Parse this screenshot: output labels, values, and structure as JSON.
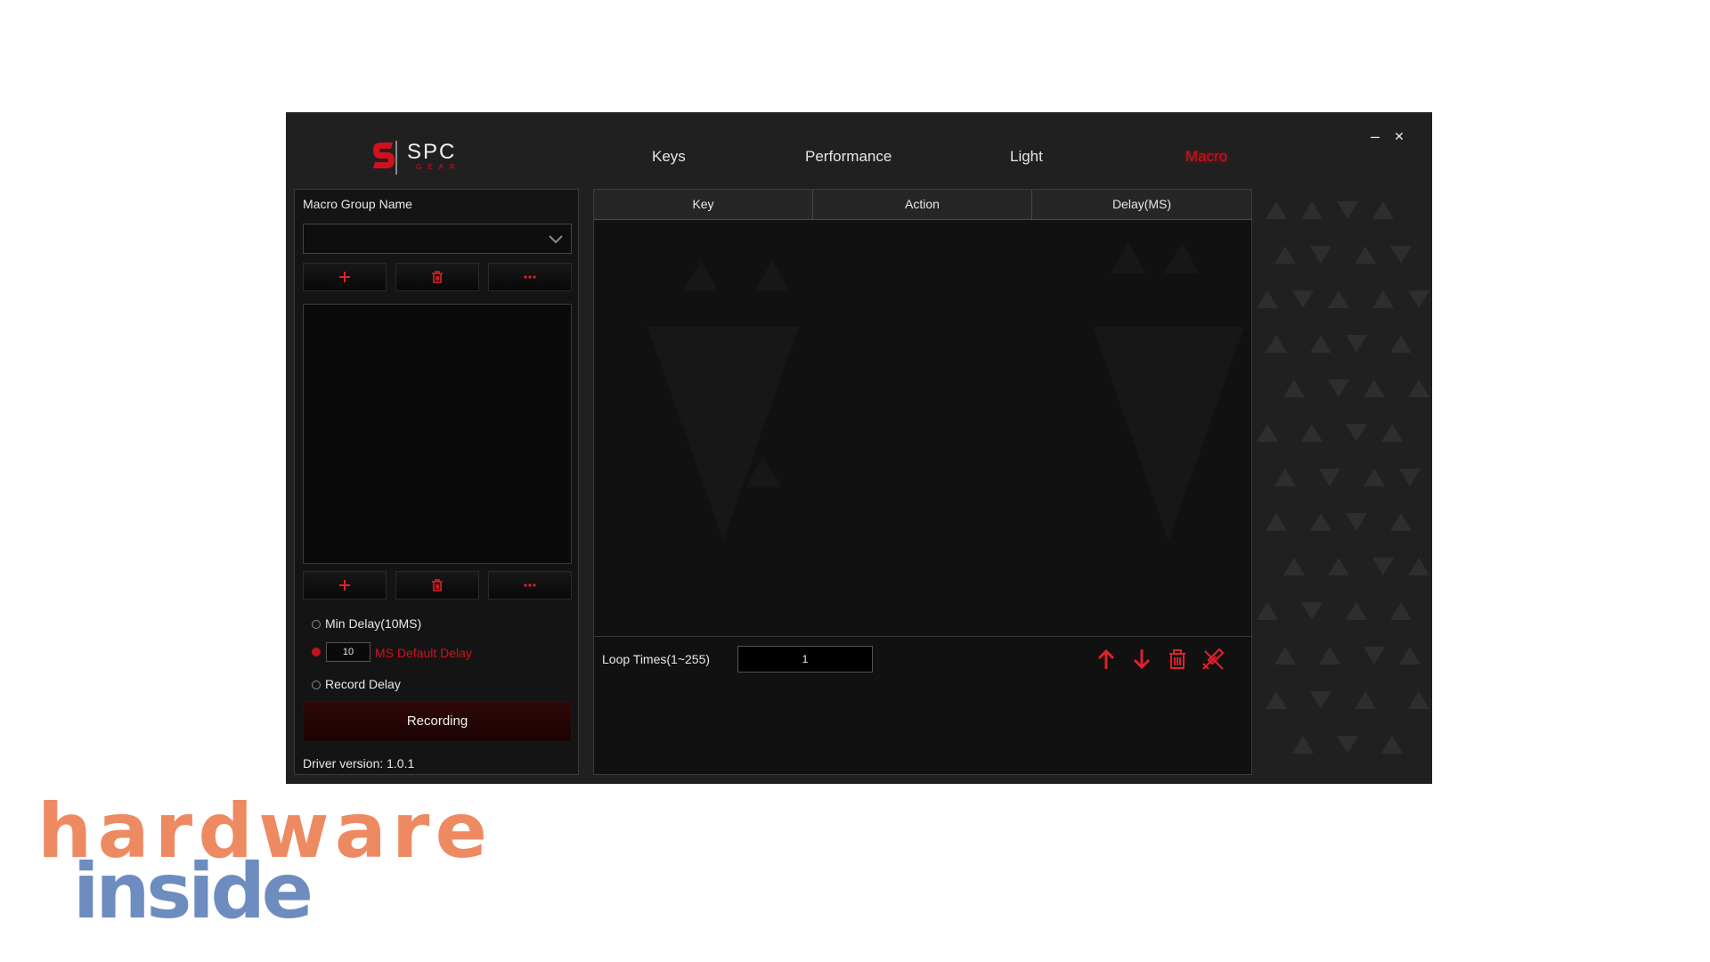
{
  "window": {
    "minimize_label": "–",
    "close_label": "✕"
  },
  "logo": {
    "brand": "SPC",
    "sub": "GEAR"
  },
  "nav": [
    "Keys",
    "Performance",
    "Light",
    "Macro"
  ],
  "left": {
    "group_label": "Macro Group Name",
    "dropdown_value": "",
    "top_buttons": [
      "add-icon",
      "trash-icon",
      "more-icon"
    ],
    "bottom_buttons": [
      "add-icon",
      "trash-icon",
      "more-icon"
    ],
    "min_delay_label": "Min Delay(10MS)",
    "default_delay_value": "10",
    "default_delay_label": "MS Default Delay",
    "record_delay_label": "Record Delay",
    "recording_label": "Recording",
    "driver_version": "Driver version: 1.0.1"
  },
  "table": {
    "columns": [
      "Key",
      "Action",
      "Delay(MS)"
    ],
    "rows": []
  },
  "footer": {
    "loop_label": "Loop Times(1~255)",
    "loop_value": "1",
    "icons": [
      "arrow-up-icon",
      "arrow-down-icon",
      "trash-icon",
      "clear-icon"
    ]
  },
  "watermark": {
    "line1": "hardware",
    "line2": "inside"
  },
  "colors": {
    "accent": "#d0121c",
    "bg": "#202020",
    "panel": "#141414",
    "wm_orange": "#ee8a62",
    "wm_blue": "#6d8cc0"
  }
}
